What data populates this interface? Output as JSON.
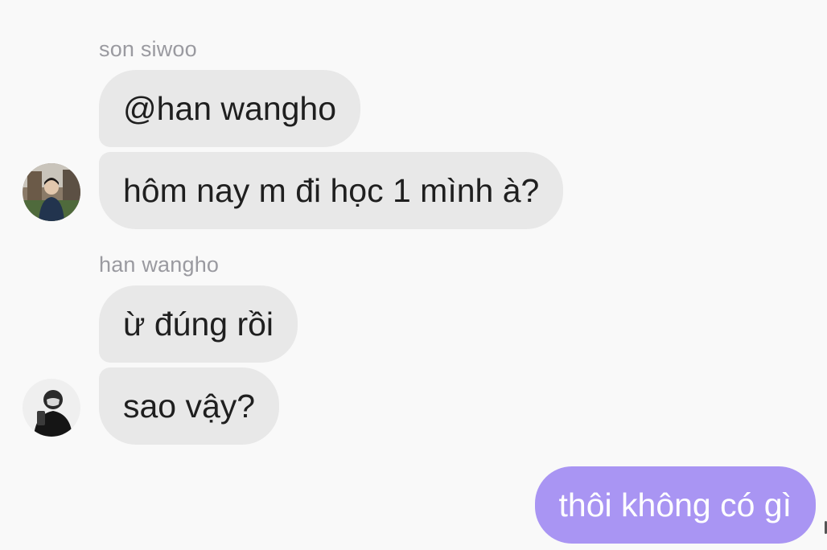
{
  "messages": {
    "group1": {
      "sender": "son siwoo",
      "bubbles": [
        "@han wangho",
        "hôm nay m đi học 1 mình à?"
      ],
      "avatar_icon": "user-avatar-photo-outdoor"
    },
    "group2": {
      "sender": "han wangho",
      "bubbles": [
        "ừ đúng rồi",
        "sao vậy?"
      ],
      "avatar_icon": "user-avatar-photo-dark"
    },
    "outgoing": {
      "bubbles": [
        "thôi không có gì"
      ]
    }
  },
  "colors": {
    "background": "#f9f9f9",
    "incoming_bubble": "#e8e8e8",
    "outgoing_bubble": "#a995f3",
    "sender_name": "#9a9aa0"
  }
}
